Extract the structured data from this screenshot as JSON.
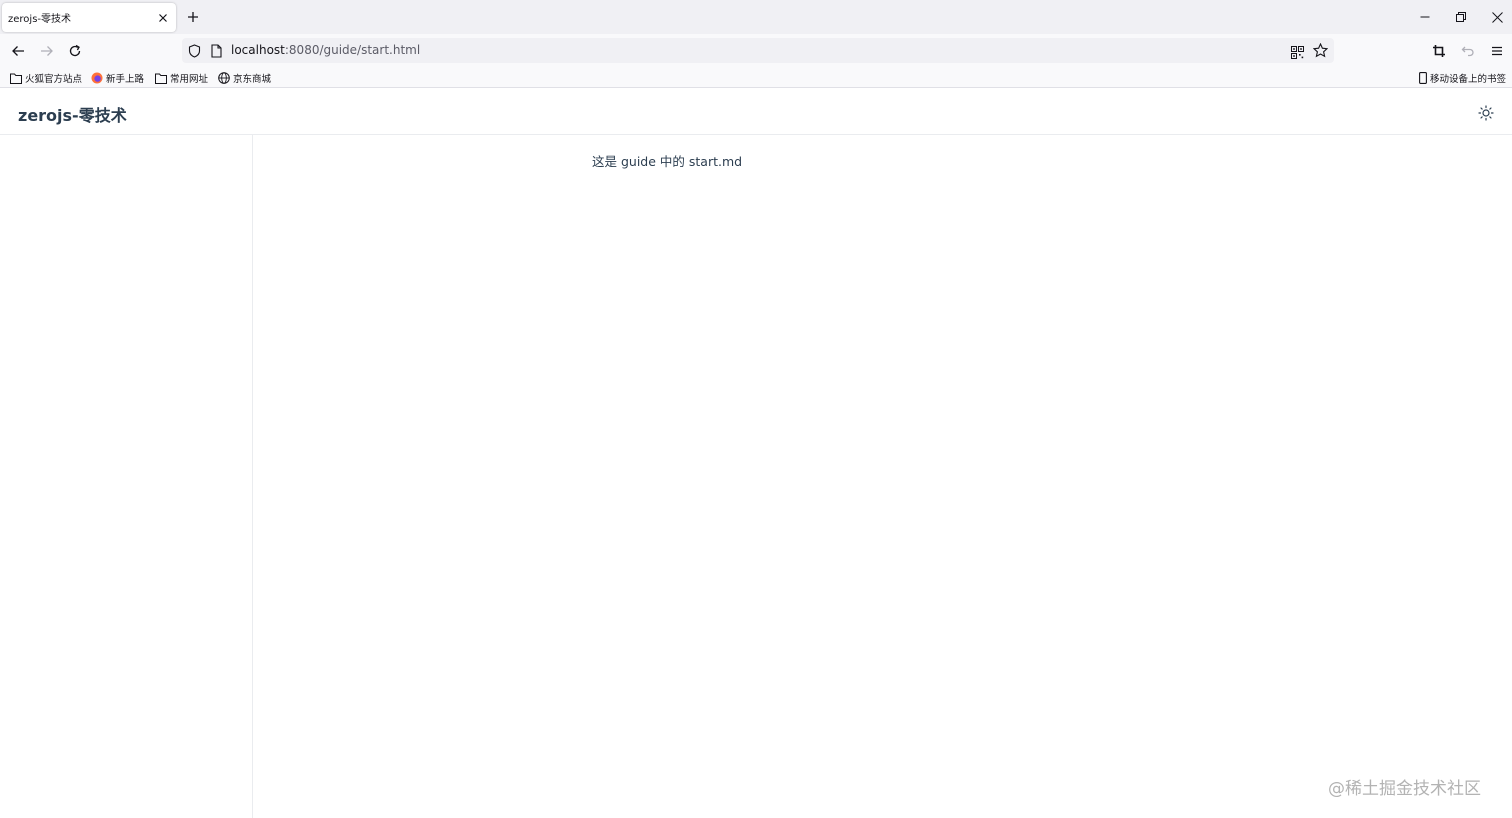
{
  "browser": {
    "tab": {
      "title": "zerojs-零技术"
    },
    "address_bar": {
      "host": "localhost",
      "rest": ":8080/guide/start.html"
    },
    "bookmarks": [
      {
        "label": "火狐官方站点",
        "icon": "folder-icon"
      },
      {
        "label": "新手上路",
        "icon": "firefox-icon"
      },
      {
        "label": "常用网址",
        "icon": "folder-icon"
      },
      {
        "label": "京东商城",
        "icon": "globe-icon"
      }
    ],
    "mobile_bookmarks": {
      "label": "移动设备上的书签",
      "icon": "mobile-icon"
    }
  },
  "site": {
    "title": "zerojs-零技术",
    "theme_toggle_icon": "sun-icon"
  },
  "content": {
    "text": "这是 guide 中的 start.md"
  },
  "watermark": "@稀土掘金技术社区",
  "colors": {
    "title": "#2c3e50",
    "border": "#eaecef",
    "chrome_bg": "#f0f0f4"
  }
}
